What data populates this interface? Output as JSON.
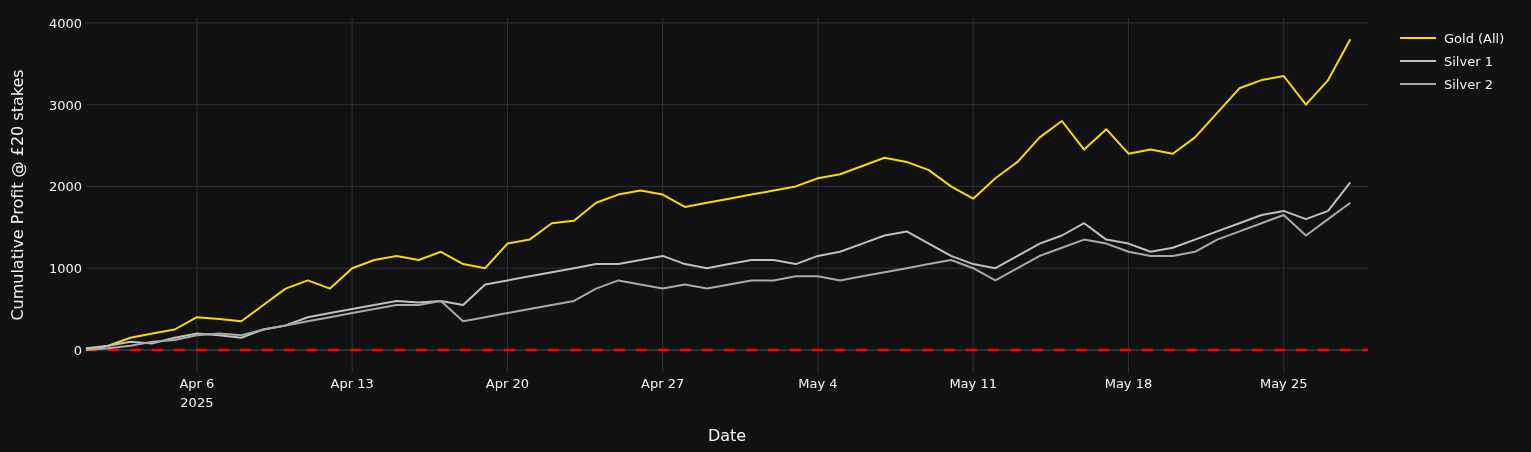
{
  "chart_data": {
    "type": "line",
    "xlabel": "Date",
    "ylabel": "Cumulative Profit @ £20 stakes",
    "categories": [
      null,
      null,
      null,
      null,
      null,
      "Apr 6\n2025",
      null,
      null,
      null,
      null,
      null,
      null,
      "Apr 13",
      null,
      null,
      null,
      null,
      null,
      null,
      "Apr 20",
      null,
      null,
      null,
      null,
      null,
      null,
      "Apr 27",
      null,
      null,
      null,
      null,
      null,
      null,
      "May 4",
      null,
      null,
      null,
      null,
      null,
      null,
      "May 11",
      null,
      null,
      null,
      null,
      null,
      null,
      "May 18",
      null,
      null,
      null,
      null,
      null,
      null,
      "May 25",
      null,
      null,
      null
    ],
    "series": [
      {
        "name": "Gold (All)",
        "color": "#ffd700",
        "values": [
          0,
          50,
          150,
          200,
          250,
          400,
          380,
          350,
          550,
          750,
          850,
          750,
          1000,
          1100,
          1150,
          1100,
          1200,
          1050,
          1000,
          1300,
          1350,
          1550,
          1580,
          1800,
          1900,
          1950,
          1900,
          1750,
          1800,
          1850,
          1900,
          1950,
          2000,
          2100,
          2150,
          2250,
          2350,
          2300,
          2200,
          2000,
          1850,
          2100,
          2300,
          2600,
          2800,
          2450,
          2700,
          2400,
          2450,
          2400,
          2600,
          2900,
          3200,
          3300,
          3350,
          3000,
          3300,
          3800
        ]
      },
      {
        "name": "Silver 1",
        "color": "#c0c0c0",
        "values": [
          20,
          50,
          100,
          80,
          150,
          200,
          180,
          150,
          250,
          300,
          400,
          450,
          500,
          550,
          600,
          580,
          600,
          550,
          800,
          850,
          900,
          950,
          1000,
          1050,
          1050,
          1100,
          1150,
          1050,
          1000,
          1050,
          1100,
          1100,
          1050,
          1150,
          1200,
          1300,
          1400,
          1450,
          1300,
          1150,
          1050,
          1000,
          1150,
          1300,
          1400,
          1550,
          1350,
          1300,
          1200,
          1250,
          1350,
          1450,
          1550,
          1650,
          1700,
          1600,
          1700,
          2050
        ]
      },
      {
        "name": "Silver 2",
        "color": "#a9a9a9",
        "values": [
          0,
          20,
          50,
          100,
          120,
          180,
          200,
          180,
          250,
          300,
          350,
          400,
          450,
          500,
          550,
          550,
          600,
          350,
          400,
          450,
          500,
          550,
          600,
          750,
          850,
          800,
          750,
          800,
          750,
          800,
          850,
          850,
          900,
          900,
          850,
          900,
          950,
          1000,
          1050,
          1100,
          1000,
          850,
          1000,
          1150,
          1250,
          1350,
          1300,
          1200,
          1150,
          1150,
          1200,
          1350,
          1450,
          1550,
          1650,
          1400,
          1600,
          1800
        ]
      }
    ],
    "ylim": [
      -270,
      4060
    ],
    "grid": true,
    "legend": true,
    "yticks": [
      0,
      1000,
      2000,
      3000,
      4000
    ],
    "ref_lines": [
      {
        "axis": "y",
        "value": 0,
        "color": "#ff0000"
      }
    ]
  }
}
